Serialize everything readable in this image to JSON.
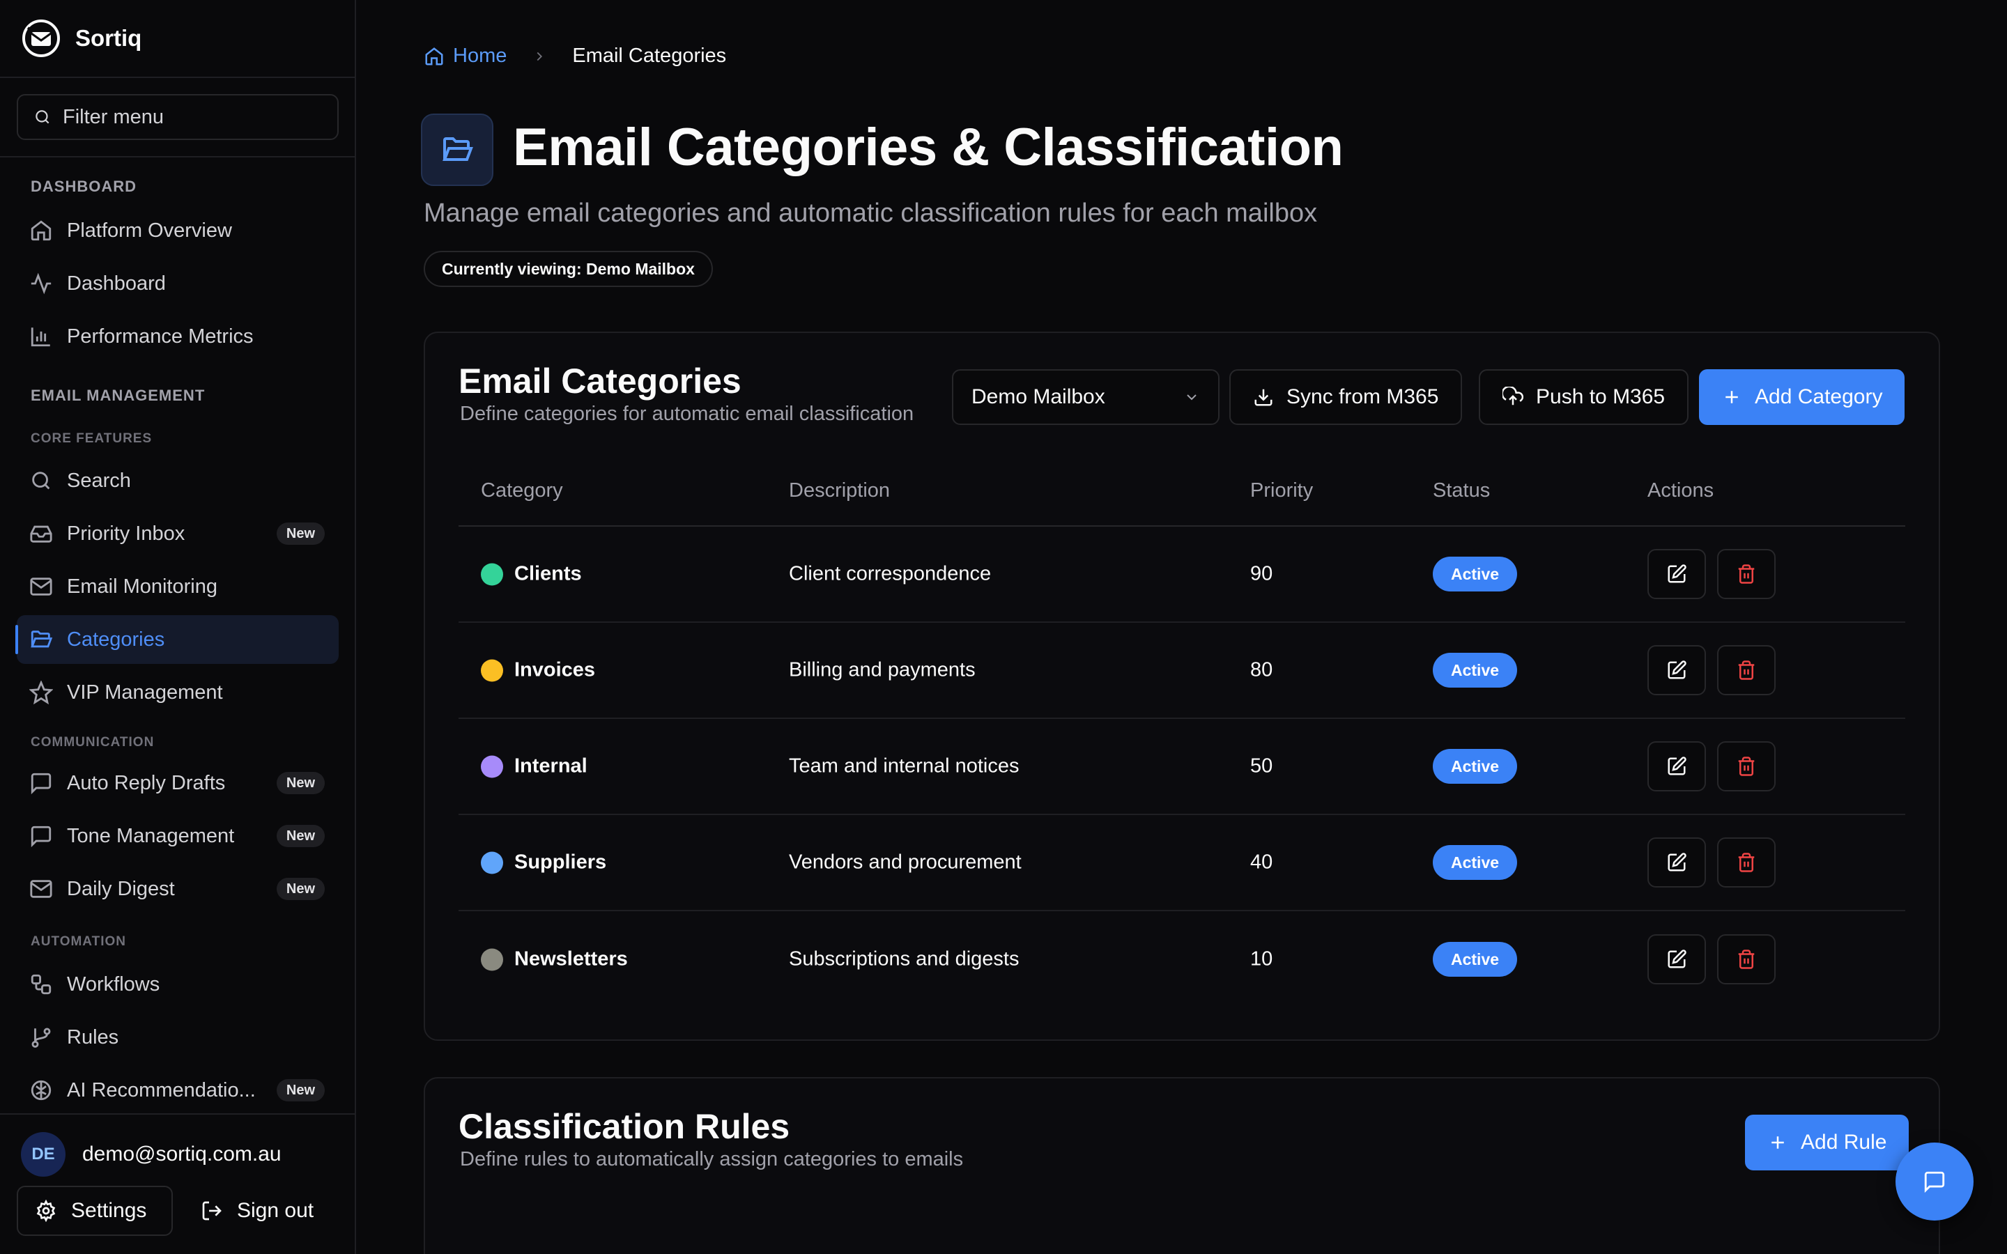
{
  "app": {
    "name": "Sortiq"
  },
  "sidebar": {
    "filter_placeholder": "Filter menu",
    "sections": {
      "dashboard": "DASHBOARD",
      "email_management": "EMAIL MANAGEMENT",
      "core_features": "CORE FEATURES",
      "communication": "COMMUNICATION",
      "automation": "AUTOMATION"
    },
    "items": [
      {
        "label": "Platform Overview",
        "icon": "home-icon"
      },
      {
        "label": "Dashboard",
        "icon": "activity-icon"
      },
      {
        "label": "Performance Metrics",
        "icon": "bar-chart-icon"
      },
      {
        "label": "Search",
        "icon": "search-icon"
      },
      {
        "label": "Priority Inbox",
        "icon": "inbox-icon",
        "badge": "New"
      },
      {
        "label": "Email Monitoring",
        "icon": "mail-icon"
      },
      {
        "label": "Categories",
        "icon": "folder-open-icon",
        "active": true
      },
      {
        "label": "VIP Management",
        "icon": "star-icon"
      },
      {
        "label": "Auto Reply Drafts",
        "icon": "message-square-icon",
        "badge": "New"
      },
      {
        "label": "Tone Management",
        "icon": "message-square-icon",
        "badge": "New"
      },
      {
        "label": "Daily Digest",
        "icon": "mail-icon",
        "badge": "New"
      },
      {
        "label": "Workflows",
        "icon": "workflow-icon"
      },
      {
        "label": "Rules",
        "icon": "git-branch-icon"
      },
      {
        "label": "AI Recommendatio...",
        "icon": "brain-icon",
        "badge": "New"
      }
    ],
    "user": {
      "initials": "DE",
      "email": "demo@sortiq.com.au"
    },
    "settings_label": "Settings",
    "signout_label": "Sign out"
  },
  "breadcrumb": {
    "home": "Home",
    "current": "Email Categories"
  },
  "page": {
    "title": "Email Categories & Classification",
    "subtitle": "Manage email categories and automatic classification rules for each mailbox",
    "viewing": "Currently viewing: Demo Mailbox"
  },
  "categories_card": {
    "title": "Email Categories",
    "description": "Define categories for automatic email classification",
    "mailbox_select": "Demo Mailbox",
    "sync_label": "Sync from M365",
    "push_label": "Push to M365",
    "add_label": "Add Category",
    "columns": [
      "Category",
      "Description",
      "Priority",
      "Status",
      "Actions"
    ],
    "rows": [
      {
        "name": "Clients",
        "description": "Client correspondence",
        "priority": "90",
        "status": "Active",
        "color": "#34d399"
      },
      {
        "name": "Invoices",
        "description": "Billing and payments",
        "priority": "80",
        "status": "Active",
        "color": "#fbbf24"
      },
      {
        "name": "Internal",
        "description": "Team and internal notices",
        "priority": "50",
        "status": "Active",
        "color": "#a78bfa"
      },
      {
        "name": "Suppliers",
        "description": "Vendors and procurement",
        "priority": "40",
        "status": "Active",
        "color": "#60a5fa"
      },
      {
        "name": "Newsletters",
        "description": "Subscriptions and digests",
        "priority": "10",
        "status": "Active",
        "color": "#8a8a80"
      }
    ]
  },
  "rules_card": {
    "title": "Classification Rules",
    "description": "Define rules to automatically assign categories to emails",
    "add_label": "Add Rule"
  },
  "colors": {
    "accent": "#3b82f6",
    "danger": "#ef4444",
    "background": "#09090b"
  }
}
